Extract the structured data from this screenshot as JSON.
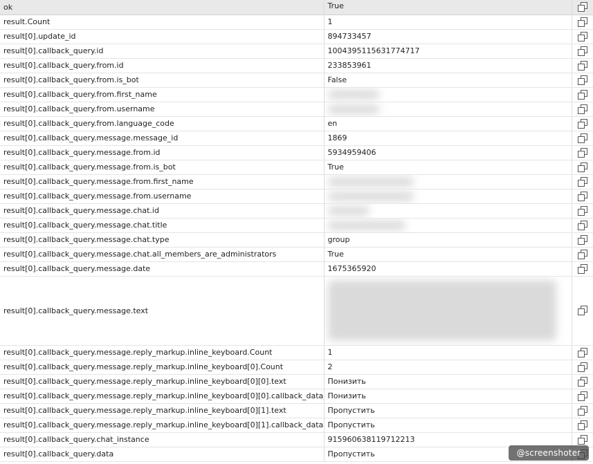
{
  "header": {
    "key": "ok",
    "value": "True"
  },
  "rows": [
    {
      "key": "result.Count",
      "value": "1"
    },
    {
      "key": "result[0].update_id",
      "value": "894733457"
    },
    {
      "key": "result[0].callback_query.id",
      "value": "1004395115631774717"
    },
    {
      "key": "result[0].callback_query.from.id",
      "value": "233853961"
    },
    {
      "key": "result[0].callback_query.from.is_bot",
      "value": "False"
    },
    {
      "key": "result[0].callback_query.from.first_name",
      "value": "",
      "redacted": true
    },
    {
      "key": "result[0].callback_query.from.username",
      "value": "",
      "redacted": true
    },
    {
      "key": "result[0].callback_query.from.language_code",
      "value": "en"
    },
    {
      "key": "result[0].callback_query.message.message_id",
      "value": "1869"
    },
    {
      "key": "result[0].callback_query.message.from.id",
      "value": "5934959406"
    },
    {
      "key": "result[0].callback_query.message.from.is_bot",
      "value": "True"
    },
    {
      "key": "result[0].callback_query.message.from.first_name",
      "value": "",
      "redacted": true
    },
    {
      "key": "result[0].callback_query.message.from.username",
      "value": "",
      "redacted": true
    },
    {
      "key": "result[0].callback_query.message.chat.id",
      "value": "",
      "redacted": true
    },
    {
      "key": "result[0].callback_query.message.chat.title",
      "value": "",
      "redacted": true
    },
    {
      "key": "result[0].callback_query.message.chat.type",
      "value": "group"
    },
    {
      "key": "result[0].callback_query.message.chat.all_members_are_administrators",
      "value": "True"
    },
    {
      "key": "result[0].callback_query.message.date",
      "value": "1675365920"
    },
    {
      "key": "result[0].callback_query.message.text",
      "value": "",
      "redacted": true,
      "tall": true
    },
    {
      "key": "result[0].callback_query.message.reply_markup.inline_keyboard.Count",
      "value": "1"
    },
    {
      "key": "result[0].callback_query.message.reply_markup.inline_keyboard[0].Count",
      "value": "2"
    },
    {
      "key": "result[0].callback_query.message.reply_markup.inline_keyboard[0][0].text",
      "value": "Понизить"
    },
    {
      "key": "result[0].callback_query.message.reply_markup.inline_keyboard[0][0].callback_data",
      "value": "Понизить"
    },
    {
      "key": "result[0].callback_query.message.reply_markup.inline_keyboard[0][1].text",
      "value": "Пропустить"
    },
    {
      "key": "result[0].callback_query.message.reply_markup.inline_keyboard[0][1].callback_data",
      "value": "Пропустить"
    },
    {
      "key": "result[0].callback_query.chat_instance",
      "value": "915960638119712213"
    },
    {
      "key": "result[0].callback_query.data",
      "value": "Пропустить"
    }
  ],
  "icons": {
    "copy": "copy-icon"
  },
  "watermark": {
    "text": "@screenshoter"
  },
  "colors": {
    "header_bg": "#e9e9e9",
    "grid_line": "#dcdcdc",
    "icon": "#555555"
  }
}
